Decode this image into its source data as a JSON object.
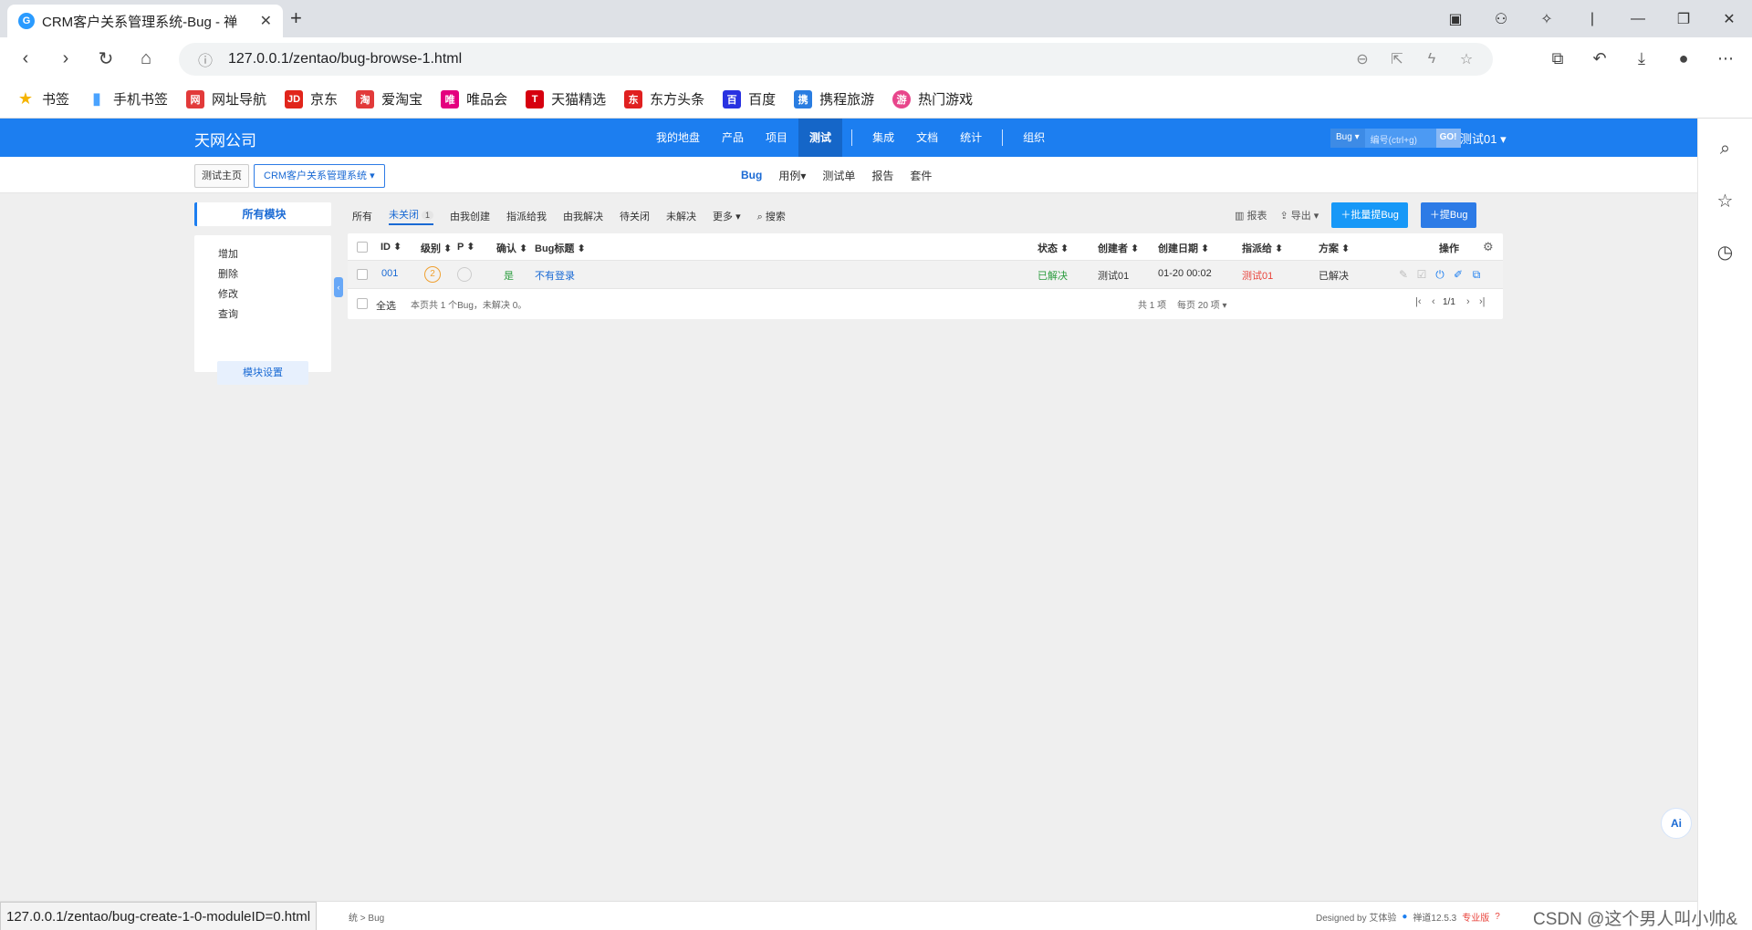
{
  "browser": {
    "tab_title": "CRM客户关系管理系统-Bug - 禅",
    "url": "127.0.0.1/zentao/bug-browse-1.html",
    "status_url": "127.0.0.1/zentao/bug-create-1-0-moduleID=0.html",
    "bookmarks": [
      {
        "label": "书签",
        "color": "#f5b400",
        "glyph": "★"
      },
      {
        "label": "手机书签",
        "color": "#4aa3ff",
        "glyph": "▮"
      },
      {
        "label": "网址导航",
        "color": "#e23a3a",
        "glyph": "网"
      },
      {
        "label": "京东",
        "color": "#e1251b",
        "glyph": "JD"
      },
      {
        "label": "爱淘宝",
        "color": "#e23a3a",
        "glyph": "淘"
      },
      {
        "label": "唯品会",
        "color": "#e4007f",
        "glyph": "唯"
      },
      {
        "label": "天猫精选",
        "color": "#d6000f",
        "glyph": "T"
      },
      {
        "label": "东方头条",
        "color": "#e02020",
        "glyph": "东"
      },
      {
        "label": "百度",
        "color": "#2932e1",
        "glyph": "百"
      },
      {
        "label": "携程旅游",
        "color": "#2a7de1",
        "glyph": "携"
      },
      {
        "label": "热门游戏",
        "color": "#e8458b",
        "glyph": "游"
      }
    ]
  },
  "header": {
    "company": "天网公司",
    "menu": [
      "我的地盘",
      "产品",
      "项目",
      "测试",
      "集成",
      "文档",
      "统计",
      "组织"
    ],
    "active_menu": "测试",
    "search_type": "Bug",
    "search_placeholder": "编号(ctrl+g)",
    "search_go": "GO!",
    "user": "测试01"
  },
  "subnav": {
    "home": "测试主页",
    "product": "CRM客户关系管理系统",
    "items": [
      "Bug",
      "用例",
      "测试单",
      "报告",
      "套件"
    ],
    "active": "Bug"
  },
  "modules": {
    "all": "所有模块",
    "items": [
      "增加",
      "删除",
      "修改",
      "查询"
    ],
    "settings": "模块设置"
  },
  "filters": {
    "items": [
      "所有",
      "未关闭",
      "由我创建",
      "指派给我",
      "由我解决",
      "待关闭",
      "未解决",
      "更多"
    ],
    "active": "未关闭",
    "active_count": "1",
    "search": "搜索"
  },
  "actions": {
    "report": "报表",
    "export": "导出",
    "batch_create": "批量提Bug",
    "create": "提Bug"
  },
  "table": {
    "headers": {
      "id": "ID",
      "severity": "级别",
      "pri": "P",
      "confirm": "确认",
      "title": "Bug标题",
      "status": "状态",
      "creator": "创建者",
      "created": "创建日期",
      "assigned": "指派给",
      "resolution": "方案",
      "actions": "操作"
    },
    "rows": [
      {
        "id": "001",
        "severity": "2",
        "confirm": "是",
        "title": "不有登录",
        "status": "已解决",
        "creator": "测试01",
        "created": "01-20 00:02",
        "assigned": "测试01",
        "resolution": "已解决"
      }
    ],
    "select_all": "全选",
    "summary": "本页共 1 个Bug，未解决 0。",
    "pager_total": "共 1 项",
    "pager_size": "每页 20 项",
    "pager_page": "1/1"
  },
  "footer": {
    "crumb": "统 > Bug",
    "designed": "Designed by 艾体验",
    "version": "禅道12.5.3",
    "edition": "专业版",
    "watermark": "CSDN @这个男人叫小帅&"
  }
}
